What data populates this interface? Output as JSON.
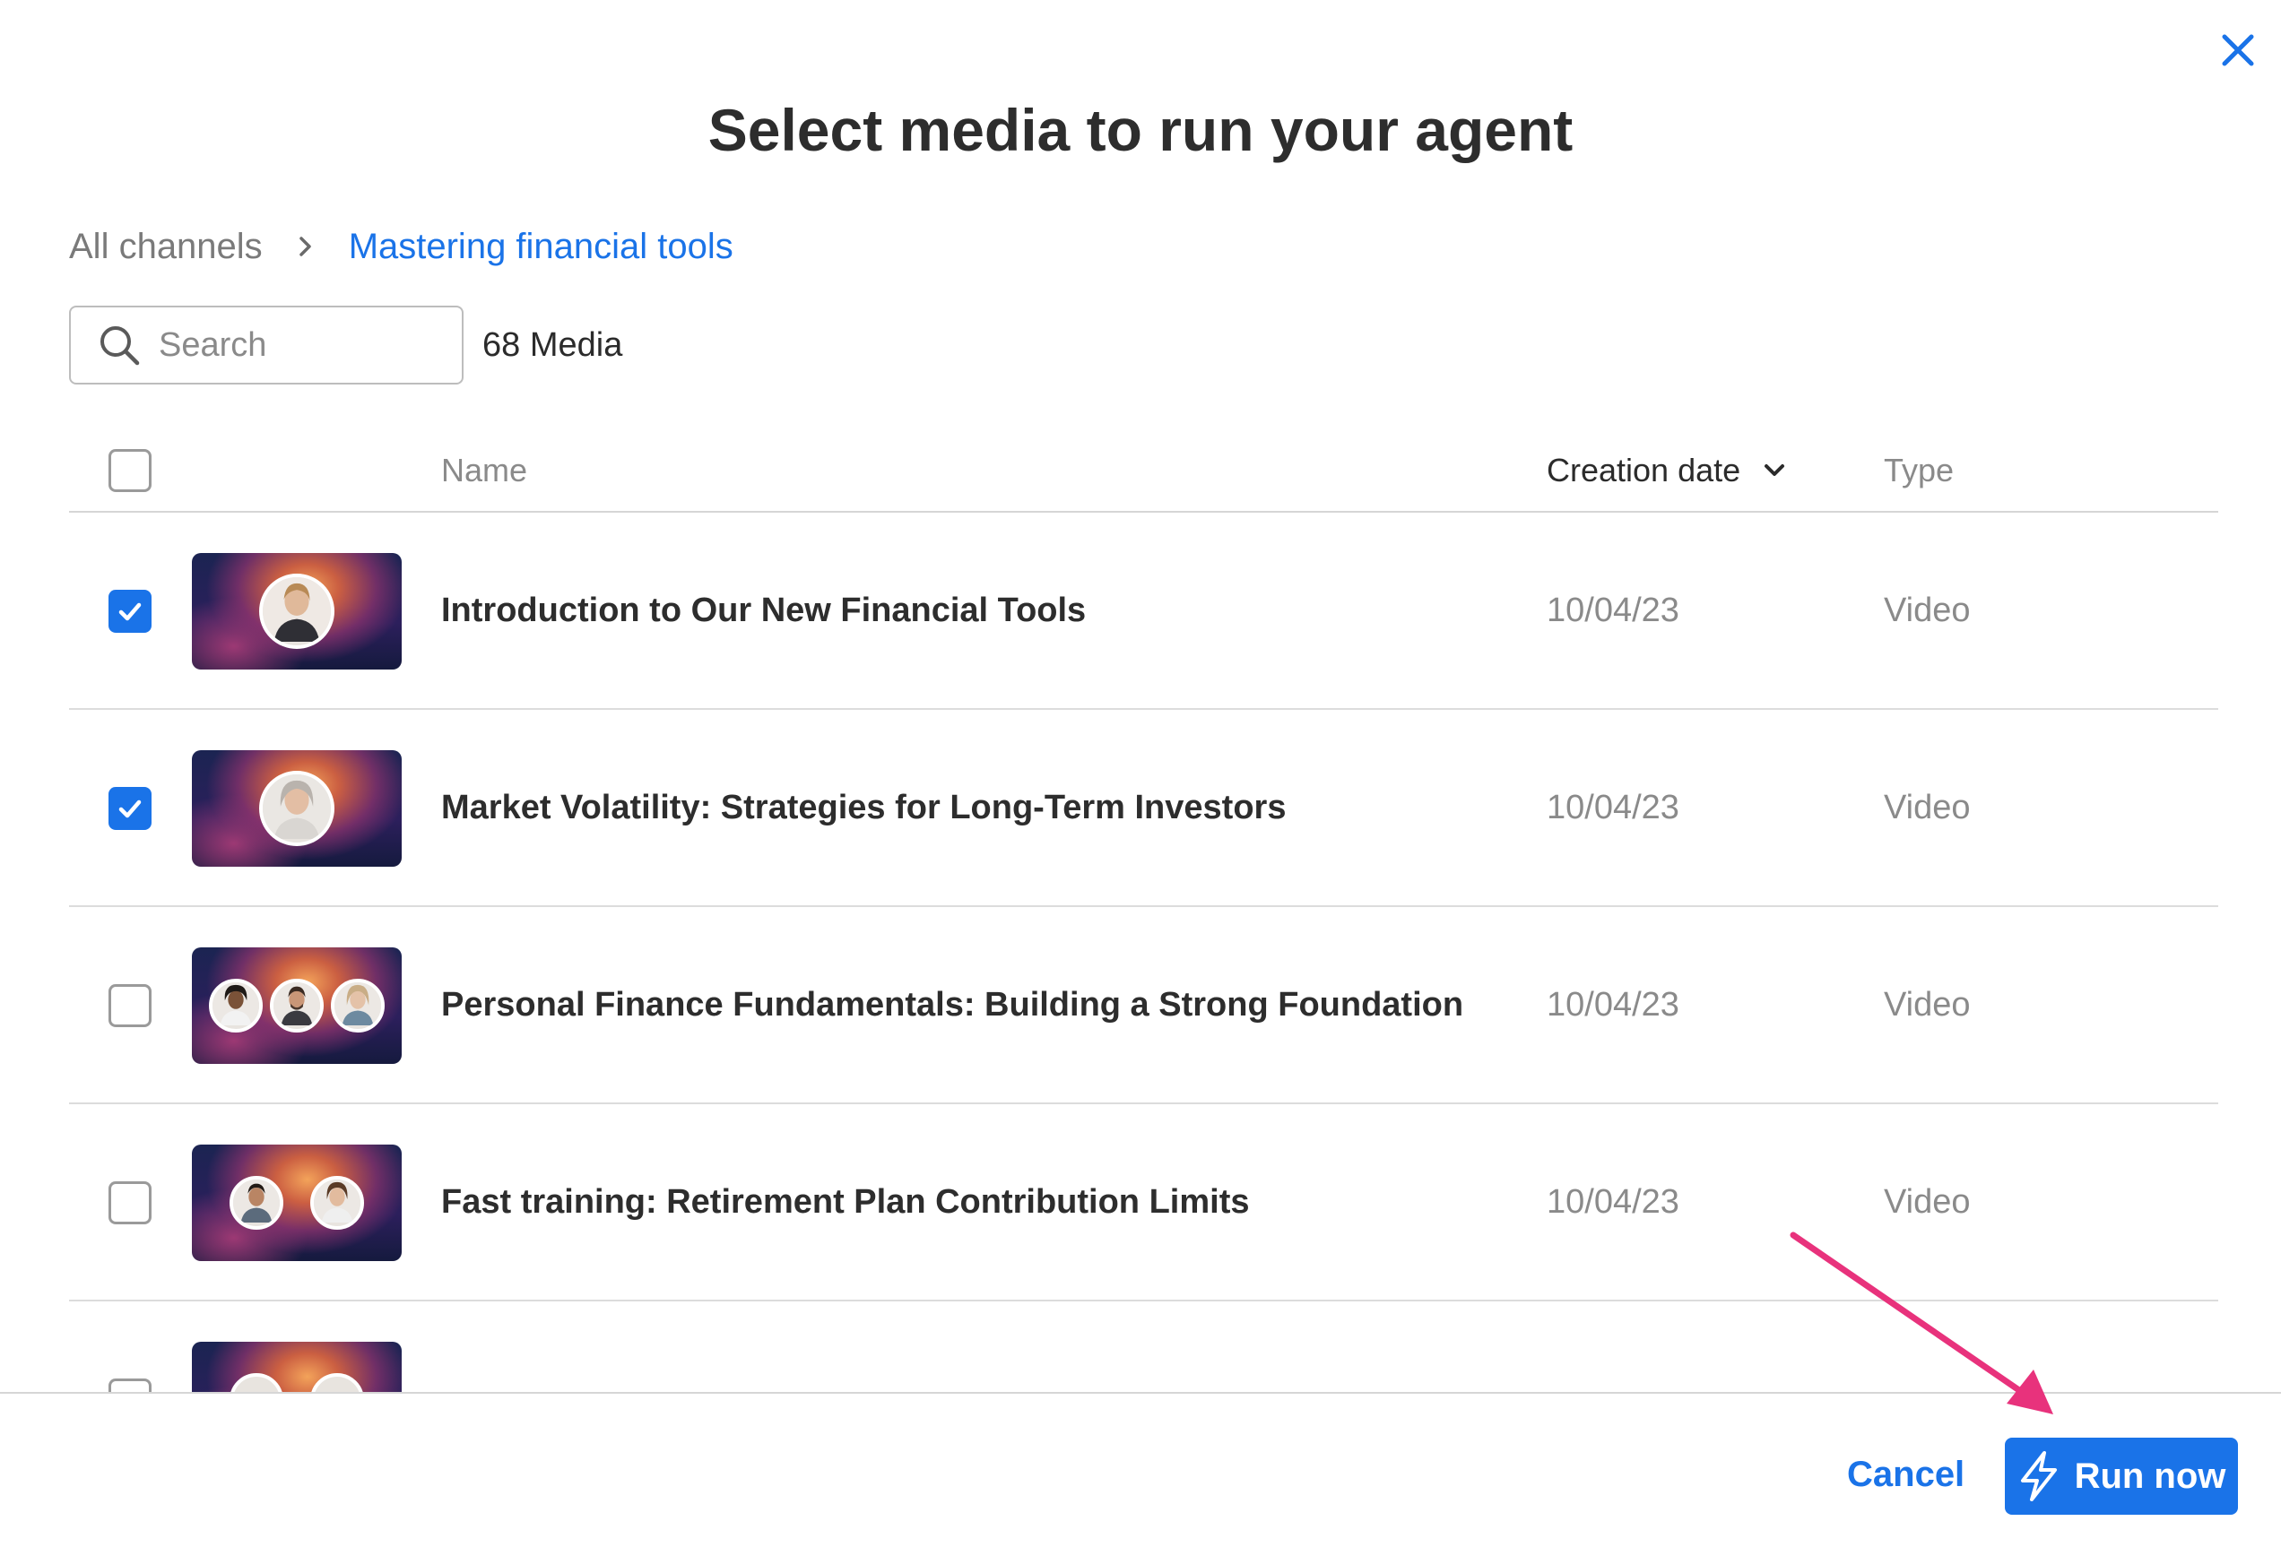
{
  "dialog": {
    "title": "Select media to run your agent"
  },
  "breadcrumb": {
    "root": "All channels",
    "current": "Mastering financial tools"
  },
  "search": {
    "placeholder": "Search",
    "value": ""
  },
  "media_count": "68 Media",
  "table": {
    "columns": {
      "name": "Name",
      "creation_date": "Creation date",
      "type": "Type"
    },
    "rows": [
      {
        "name": "Introduction to Our New Financial Tools",
        "date": "10/04/23",
        "type": "Video",
        "checked": true
      },
      {
        "name": "Market Volatility: Strategies for Long-Term Investors",
        "date": "10/04/23",
        "type": "Video",
        "checked": true
      },
      {
        "name": "Personal Finance Fundamentals: Building a Strong Foundation",
        "date": "10/04/23",
        "type": "Video",
        "checked": false
      },
      {
        "name": "Fast training: Retirement Plan Contribution Limits",
        "date": "10/04/23",
        "type": "Video",
        "checked": false
      }
    ]
  },
  "footer": {
    "cancel_label": "Cancel",
    "run_label": "Run now"
  },
  "icons": {
    "close": "close-icon",
    "chevron_right": "chevron-right-icon",
    "search": "search-icon",
    "sort": "chevron-down-icon",
    "check": "checkmark-icon",
    "bolt": "lightning-bolt-icon"
  },
  "colors": {
    "accent": "#1a73e8",
    "annotation_arrow": "#e8327c"
  }
}
